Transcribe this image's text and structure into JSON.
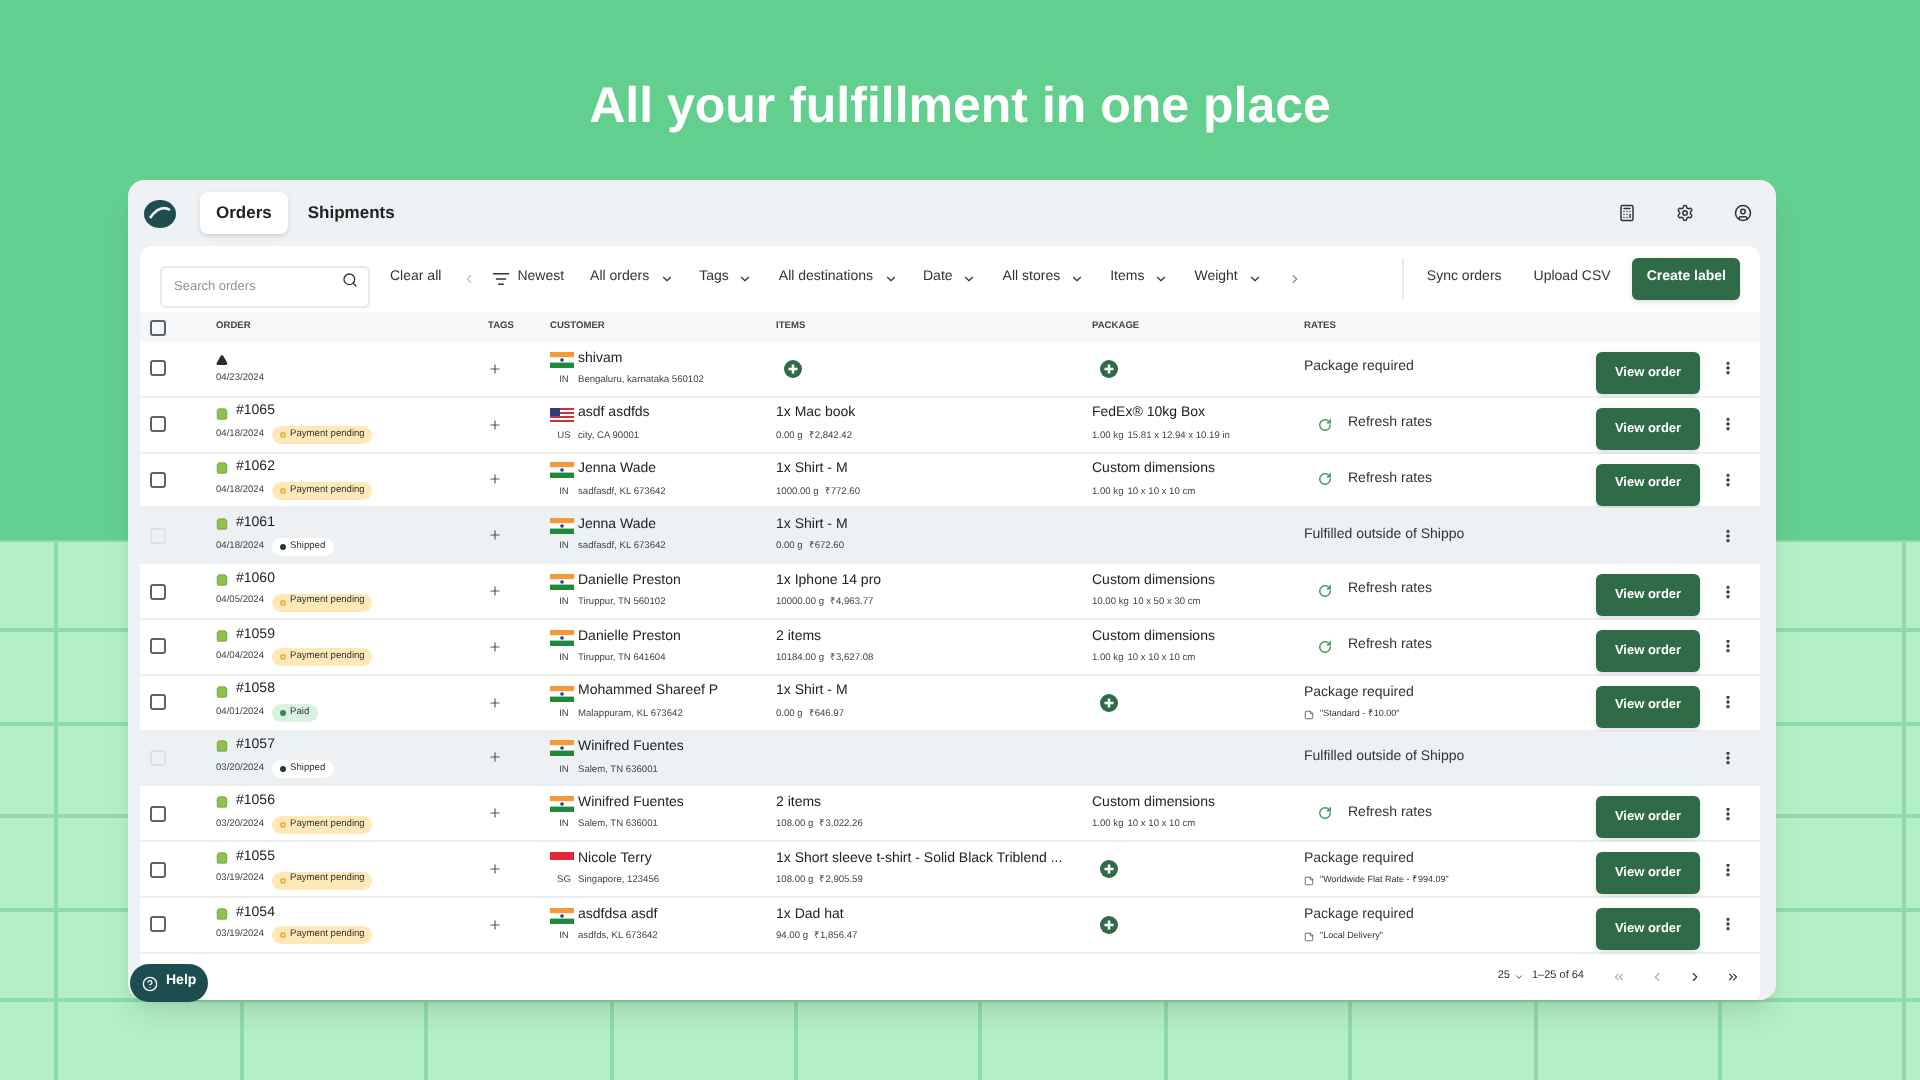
{
  "headline": "All your fulfillment in one place",
  "tabs": [
    {
      "label": "Orders",
      "selected": true
    },
    {
      "label": "Shipments",
      "selected": false
    }
  ],
  "toolbar": {
    "search": {
      "placeholder": "Search orders"
    },
    "clear": "Clear all",
    "sort": "Newest",
    "filters": [
      "All orders",
      "Tags",
      "All destinations",
      "Date",
      "All stores",
      "Items",
      "Weight"
    ],
    "actions": [
      {
        "label": "Sync orders",
        "kind": "plain"
      },
      {
        "label": "Upload CSV",
        "kind": "plain"
      },
      {
        "label": "Create label",
        "kind": "primary"
      }
    ]
  },
  "table": {
    "select_all": {
      "checked": false
    },
    "columns": [
      "ORDER",
      "TAGS",
      "CUSTOMER",
      "ITEMS",
      "PACKAGE",
      "RATES"
    ],
    "rows": [
      {
        "store": {
          "kind": "other"
        },
        "number": "",
        "date": "04/23/2024",
        "checked": false,
        "disabled": false,
        "flag": {
          "kind": "in"
        },
        "country": "IN",
        "customer": "shivam",
        "address": "Bengaluru, karnataka 560102",
        "items": {
          "kind": "add"
        },
        "package": {
          "kind": "add"
        },
        "rates": {
          "kind": "required",
          "text": "Package required"
        },
        "action": "View order"
      },
      {
        "store": {
          "kind": "shop"
        },
        "number": "#1065",
        "date": "04/18/2024",
        "badge": {
          "kind": "pending",
          "label": "Payment pending"
        },
        "checked": false,
        "disabled": false,
        "flag": {
          "kind": "us"
        },
        "country": "US",
        "customer": "asdf asdfds",
        "address": "city, CA 90001",
        "items": {
          "kind": "list",
          "title": "1x Mac book",
          "weight": "0.00 g",
          "price": "₹2,842.42"
        },
        "package": {
          "kind": "box",
          "title": "FedEx® 10kg Box",
          "weight": "1.00 kg",
          "dims": "15.81 x 12.94 x 10.19 in"
        },
        "rates": {
          "kind": "refresh",
          "text": "Refresh rates"
        },
        "action": "View order"
      },
      {
        "store": {
          "kind": "shop"
        },
        "number": "#1062",
        "date": "04/18/2024",
        "badge": {
          "kind": "pending",
          "label": "Payment pending"
        },
        "checked": false,
        "disabled": false,
        "flag": {
          "kind": "in"
        },
        "country": "IN",
        "customer": "Jenna Wade",
        "address": "sadfasdf, KL 673642",
        "items": {
          "kind": "list",
          "title": "1x Shirt - M",
          "weight": "1000.00 g",
          "price": "₹772.60"
        },
        "package": {
          "kind": "box",
          "title": "Custom dimensions",
          "weight": "1.00 kg",
          "dims": "10 x 10 x 10 cm"
        },
        "rates": {
          "kind": "refresh",
          "text": "Refresh rates"
        },
        "action": "View order"
      },
      {
        "store": {
          "kind": "shop"
        },
        "number": "#1061",
        "date": "04/18/2024",
        "badge": {
          "kind": "shipped",
          "label": "Shipped"
        },
        "checked": false,
        "disabled": true,
        "flag": {
          "kind": "in"
        },
        "country": "IN",
        "customer": "Jenna Wade",
        "address": "sadfasdf, KL 673642",
        "items": {
          "kind": "list",
          "title": "1x Shirt - M",
          "weight": "0.00 g",
          "price": "₹672.60"
        },
        "package": {
          "kind": "none"
        },
        "rates": {
          "kind": "fulfilled",
          "text": "Fulfilled outside of Shippo"
        }
      },
      {
        "store": {
          "kind": "shop"
        },
        "number": "#1060",
        "date": "04/05/2024",
        "badge": {
          "kind": "pending",
          "label": "Payment pending"
        },
        "checked": false,
        "disabled": false,
        "flag": {
          "kind": "in"
        },
        "country": "IN",
        "customer": "Danielle Preston",
        "address": "Tiruppur, TN 560102",
        "items": {
          "kind": "list",
          "title": "1x Iphone 14 pro",
          "weight": "10000.00 g",
          "price": "₹4,963.77"
        },
        "package": {
          "kind": "box",
          "title": "Custom dimensions",
          "weight": "10.00 kg",
          "dims": "10 x 50 x 30 cm"
        },
        "rates": {
          "kind": "refresh",
          "text": "Refresh rates"
        },
        "action": "View order"
      },
      {
        "store": {
          "kind": "shop"
        },
        "number": "#1059",
        "date": "04/04/2024",
        "badge": {
          "kind": "pending",
          "label": "Payment pending"
        },
        "checked": false,
        "disabled": false,
        "flag": {
          "kind": "in"
        },
        "country": "IN",
        "customer": "Danielle Preston",
        "address": "Tiruppur, TN 641604",
        "items": {
          "kind": "list",
          "title": "2 items",
          "weight": "10184.00 g",
          "price": "₹3,627.08"
        },
        "package": {
          "kind": "box",
          "title": "Custom dimensions",
          "weight": "1.00 kg",
          "dims": "10 x 10 x 10 cm"
        },
        "rates": {
          "kind": "refresh",
          "text": "Refresh rates"
        },
        "action": "View order"
      },
      {
        "store": {
          "kind": "shop"
        },
        "number": "#1058",
        "date": "04/01/2024",
        "badge": {
          "kind": "paid",
          "label": "Paid"
        },
        "checked": false,
        "disabled": false,
        "flag": {
          "kind": "in"
        },
        "country": "IN",
        "customer": "Mohammed Shareef P",
        "address": "Malappuram, KL 673642",
        "items": {
          "kind": "list",
          "title": "1x Shirt - M",
          "weight": "0.00 g",
          "price": "₹646.97"
        },
        "package": {
          "kind": "add"
        },
        "rates": {
          "kind": "required",
          "text": "Package required",
          "note": "\"Standard - ₹10.00\""
        },
        "action": "View order"
      },
      {
        "store": {
          "kind": "shop"
        },
        "number": "#1057",
        "date": "03/20/2024",
        "badge": {
          "kind": "shipped",
          "label": "Shipped"
        },
        "checked": false,
        "disabled": true,
        "flag": {
          "kind": "in"
        },
        "country": "IN",
        "customer": "Winifred Fuentes",
        "address": "Salem, TN 636001",
        "items": {
          "kind": "none"
        },
        "package": {
          "kind": "none"
        },
        "rates": {
          "kind": "fulfilled",
          "text": "Fulfilled outside of Shippo"
        }
      },
      {
        "store": {
          "kind": "shop"
        },
        "number": "#1056",
        "date": "03/20/2024",
        "badge": {
          "kind": "pending",
          "label": "Payment pending"
        },
        "checked": false,
        "disabled": false,
        "flag": {
          "kind": "in"
        },
        "country": "IN",
        "customer": "Winifred Fuentes",
        "address": "Salem, TN 636001",
        "items": {
          "kind": "list",
          "title": "2 items",
          "weight": "108.00 g",
          "price": "₹3,022.26"
        },
        "package": {
          "kind": "box",
          "title": "Custom dimensions",
          "weight": "1.00 kg",
          "dims": "10 x 10 x 10 cm"
        },
        "rates": {
          "kind": "refresh",
          "text": "Refresh rates"
        },
        "action": "View order"
      },
      {
        "store": {
          "kind": "shop"
        },
        "number": "#1055",
        "date": "03/19/2024",
        "badge": {
          "kind": "pending",
          "label": "Payment pending"
        },
        "checked": false,
        "disabled": false,
        "flag": {
          "kind": "sg"
        },
        "country": "SG",
        "customer": "Nicole Terry",
        "address": "Singapore, 123456",
        "items": {
          "kind": "list",
          "title": "1x Short sleeve t-shirt - Solid Black Triblend ...",
          "weight": "108.00 g",
          "price": "₹2,905.59"
        },
        "package": {
          "kind": "add"
        },
        "rates": {
          "kind": "required",
          "text": "Package required",
          "note": "\"Worldwide Flat Rate - ₹994.09\""
        },
        "action": "View order"
      },
      {
        "store": {
          "kind": "shop"
        },
        "number": "#1054",
        "date": "03/19/2024",
        "badge": {
          "kind": "pending",
          "label": "Payment pending"
        },
        "checked": false,
        "disabled": false,
        "flag": {
          "kind": "in"
        },
        "country": "IN",
        "customer": "asdfdsa asdf",
        "address": "asdfds, KL 673642",
        "items": {
          "kind": "list",
          "title": "1x Dad hat",
          "weight": "94.00 g",
          "price": "₹1,856.47"
        },
        "package": {
          "kind": "add"
        },
        "rates": {
          "kind": "required",
          "text": "Package required",
          "note": "\"Local Delivery\""
        },
        "action": "View order"
      }
    ]
  },
  "pagination": {
    "per_page": "25",
    "range": "1–25 of 64"
  },
  "help": "Help"
}
